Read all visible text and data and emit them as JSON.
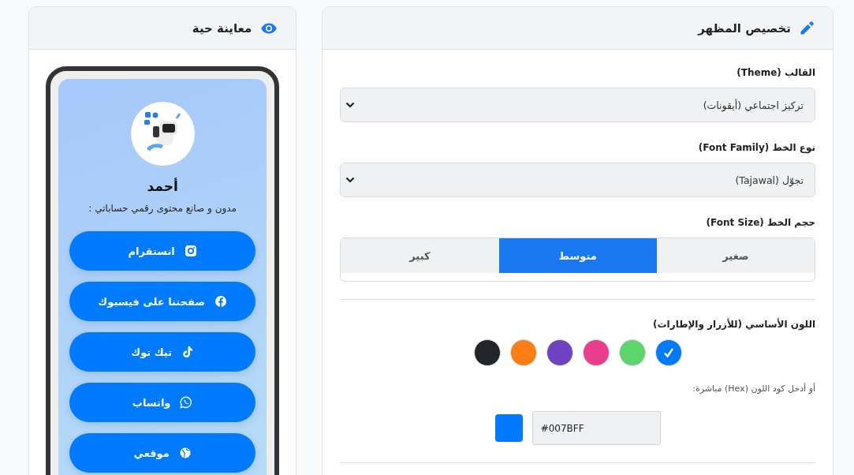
{
  "preview": {
    "title": "معاينة حية",
    "profile": {
      "name": "أحمد",
      "bio": "مدون و صانع محتوى رقمي حساباتي :"
    },
    "links": [
      {
        "label": "انستقرام",
        "kind": "instagram"
      },
      {
        "label": "صفحتنا على فيسبوك",
        "kind": "facebook"
      },
      {
        "label": "تيك توك",
        "kind": "tiktok"
      },
      {
        "label": "واتساب",
        "kind": "whatsapp"
      },
      {
        "label": "موقعي",
        "kind": "website"
      }
    ]
  },
  "settings": {
    "title": "تخصيص المظهر",
    "theme": {
      "label": "القالب (Theme)",
      "value": "تركيز اجتماعي (أيقونات)"
    },
    "font_family": {
      "label": "نوع الخط (Font Family)",
      "value": "تجوّل (Tajawal)"
    },
    "font_size": {
      "label": "حجم الخط (Font Size)",
      "options": [
        {
          "label": "صغير",
          "selected": false
        },
        {
          "label": "متوسط",
          "selected": true
        },
        {
          "label": "كبير",
          "selected": false
        }
      ]
    },
    "primary_color": {
      "label": "اللون الأساسي (للأزرار والإطارات)",
      "swatches": [
        {
          "color": "#007bff",
          "selected": true
        },
        {
          "color": "#5cd66b",
          "selected": false
        },
        {
          "color": "#e83e8c",
          "selected": false
        },
        {
          "color": "#6f42c1",
          "selected": false
        },
        {
          "color": "#fd7e14",
          "selected": false
        },
        {
          "color": "#212529",
          "selected": false
        }
      ],
      "hex_hint": "أو أدخل كود اللون (Hex) مباشرة:",
      "hex_value": "#007BFF"
    }
  }
}
